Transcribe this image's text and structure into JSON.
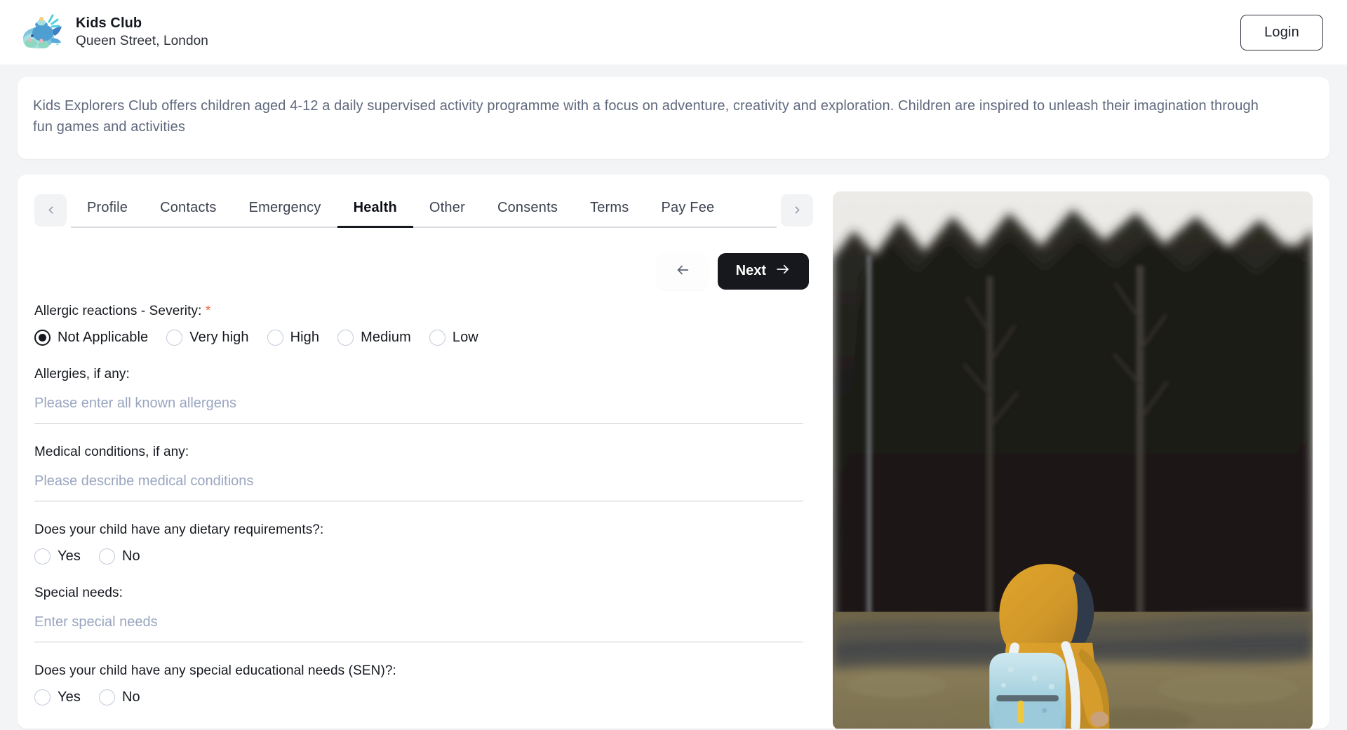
{
  "header": {
    "logo_icon": "whale-logo-icon",
    "club_name": "Kids Club",
    "location": "Queen Street, London",
    "login_label": "Login"
  },
  "description": {
    "text": "Kids Explorers Club offers children aged 4-12 a daily supervised activity programme with a focus on adventure, creativity and exploration. Children are inspired to unleash their imagination through fun games and activities"
  },
  "tabs": {
    "prev_icon": "chevron-left-icon",
    "next_icon": "chevron-right-icon",
    "items": [
      {
        "label": "Profile",
        "active": false
      },
      {
        "label": "Contacts",
        "active": false
      },
      {
        "label": "Emergency",
        "active": false
      },
      {
        "label": "Health",
        "active": true
      },
      {
        "label": "Other",
        "active": false
      },
      {
        "label": "Consents",
        "active": false
      },
      {
        "label": "Terms",
        "active": false
      },
      {
        "label": "Pay Fee",
        "active": false
      }
    ]
  },
  "nav": {
    "back_icon": "arrow-left-icon",
    "next_label": "Next",
    "next_icon": "arrow-right-icon"
  },
  "form": {
    "severity": {
      "label": "Allergic reactions - Severity:",
      "required_mark": "*",
      "options": [
        {
          "label": "Not Applicable",
          "checked": true
        },
        {
          "label": "Very high",
          "checked": false
        },
        {
          "label": "High",
          "checked": false
        },
        {
          "label": "Medium",
          "checked": false
        },
        {
          "label": "Low",
          "checked": false
        }
      ]
    },
    "allergies": {
      "label": "Allergies, if any:",
      "placeholder": "Please enter all known allergens",
      "value": ""
    },
    "medical": {
      "label": "Medical conditions, if any:",
      "placeholder": "Please describe medical conditions",
      "value": ""
    },
    "dietary": {
      "label": "Does your child have any dietary requirements?:",
      "options": [
        {
          "label": "Yes",
          "checked": false
        },
        {
          "label": "No",
          "checked": false
        }
      ]
    },
    "special_needs": {
      "label": "Special needs:",
      "placeholder": "Enter special needs",
      "value": ""
    },
    "sen": {
      "label": "Does your child have any special educational needs (SEN)?:",
      "options": [
        {
          "label": "Yes",
          "checked": false
        },
        {
          "label": "No",
          "checked": false
        }
      ]
    }
  },
  "media": {
    "alt": "Child in a yellow raincoat with a light blue backpack standing on grass in front of a dark treeline"
  },
  "colors": {
    "page_bg": "#f3f4f6",
    "card_bg": "#ffffff",
    "text": "#15181f",
    "muted_text": "#60697d",
    "placeholder": "#9aa6c0",
    "accent_dark": "#16181d",
    "required": "#ef6c47",
    "divider": "#c9ccd2"
  }
}
